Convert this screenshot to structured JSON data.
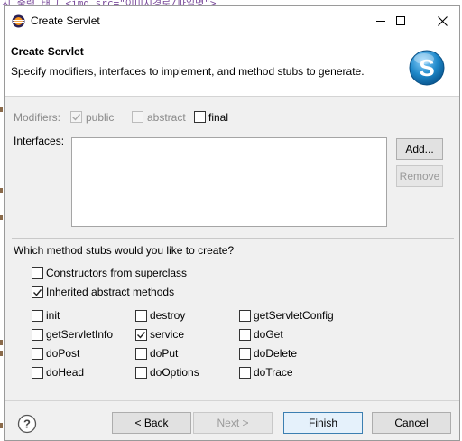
{
  "background": {
    "code_fragment": "시 출력 태그 <img src=\"이미지경로/파일명\">"
  },
  "window": {
    "title": "Create Servlet",
    "controls": {
      "minimize": "minimize",
      "maximize": "maximize",
      "close": "close"
    }
  },
  "header": {
    "title": "Create Servlet",
    "description": "Specify modifiers, interfaces to implement, and method stubs to generate.",
    "logo_letter": "S"
  },
  "modifiers": {
    "label": "Modifiers:",
    "public": {
      "label": "public",
      "checked": true,
      "enabled": false
    },
    "abstract": {
      "label": "abstract",
      "checked": false,
      "enabled": false
    },
    "final": {
      "label": "final",
      "checked": false,
      "enabled": true
    }
  },
  "interfaces": {
    "label": "Interfaces:",
    "items": [],
    "add_button": "Add...",
    "remove_button": "Remove"
  },
  "stubs": {
    "question": "Which method stubs would you like to create?",
    "constructors": {
      "label": "Constructors from superclass",
      "checked": false
    },
    "inherited": {
      "label": "Inherited abstract methods",
      "checked": true
    },
    "methods": [
      {
        "label": "init",
        "checked": false
      },
      {
        "label": "destroy",
        "checked": false
      },
      {
        "label": "getServletConfig",
        "checked": false
      },
      {
        "label": "getServletInfo",
        "checked": false
      },
      {
        "label": "service",
        "checked": true
      },
      {
        "label": "doGet",
        "checked": false
      },
      {
        "label": "doPost",
        "checked": false
      },
      {
        "label": "doPut",
        "checked": false
      },
      {
        "label": "doDelete",
        "checked": false
      },
      {
        "label": "doHead",
        "checked": false
      },
      {
        "label": "doOptions",
        "checked": false
      },
      {
        "label": "doTrace",
        "checked": false
      }
    ]
  },
  "footer": {
    "help": "?",
    "back": "< Back",
    "next": "Next >",
    "finish": "Finish",
    "cancel": "Cancel"
  },
  "colors": {
    "dialog_bg": "#f0f0f0",
    "header_bg": "#ffffff",
    "logo_blue": "#1e88c9",
    "primary_border": "#3c7fb1"
  }
}
